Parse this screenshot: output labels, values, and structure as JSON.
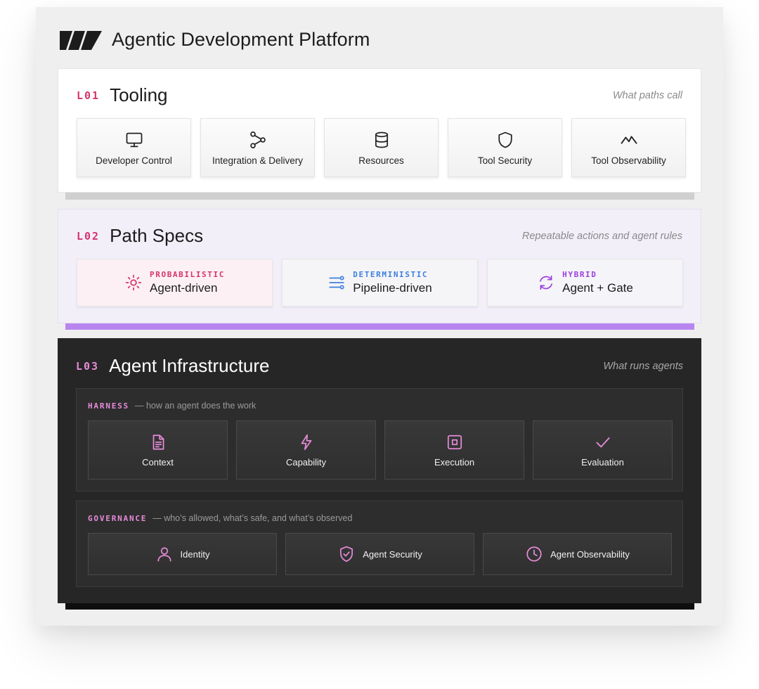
{
  "app": {
    "title": "Agentic Development Platform",
    "logo_icon": "brand-mark-logo"
  },
  "colors": {
    "accent_pink": "#d6336c",
    "accent_violet": "#b885f0",
    "accent_blue": "#3f7fe0",
    "dark_panel": "#262626"
  },
  "layers": {
    "tooling": {
      "code": "L01",
      "name": "Tooling",
      "tagline": "What paths call",
      "items": [
        {
          "label": "Developer Control",
          "icon": "monitor-icon"
        },
        {
          "label": "Integration & Delivery",
          "icon": "nodes-share-icon"
        },
        {
          "label": "Resources",
          "icon": "database-icon"
        },
        {
          "label": "Tool Security",
          "icon": "shield-icon"
        },
        {
          "label": "Tool Observability",
          "icon": "activity-wave-icon"
        }
      ]
    },
    "path_specs": {
      "code": "L02",
      "name": "Path Specs",
      "tagline": "Repeatable actions and agent rules",
      "items": [
        {
          "kind": "PROBABILISTIC",
          "label": "Agent-driven",
          "icon": "sun-sparkle-icon",
          "color": "#d6336c"
        },
        {
          "kind": "DETERMINISTIC",
          "label": "Pipeline-driven",
          "icon": "sliders-icon",
          "color": "#3f7fe0"
        },
        {
          "kind": "HYBRID",
          "label": "Agent + Gate",
          "icon": "cycle-arrows-icon",
          "color": "#9b3fe0"
        }
      ]
    },
    "agent_infrastructure": {
      "code": "L03",
      "name": "Agent Infrastructure",
      "tagline": "What runs agents",
      "harness": {
        "name": "HARNESS",
        "description": "— how an agent does the work",
        "items": [
          {
            "label": "Context",
            "icon": "document-icon"
          },
          {
            "label": "Capability",
            "icon": "lightning-icon"
          },
          {
            "label": "Execution",
            "icon": "chip-square-icon"
          },
          {
            "label": "Evaluation",
            "icon": "checkmark-icon"
          }
        ]
      },
      "governance": {
        "name": "GOVERNANCE",
        "description": "— who’s allowed, what’s safe, and what’s observed",
        "items": [
          {
            "label": "Identity",
            "icon": "user-icon"
          },
          {
            "label": "Agent Security",
            "icon": "shield-check-icon"
          },
          {
            "label": "Agent Observability",
            "icon": "clock-icon"
          }
        ]
      }
    }
  }
}
